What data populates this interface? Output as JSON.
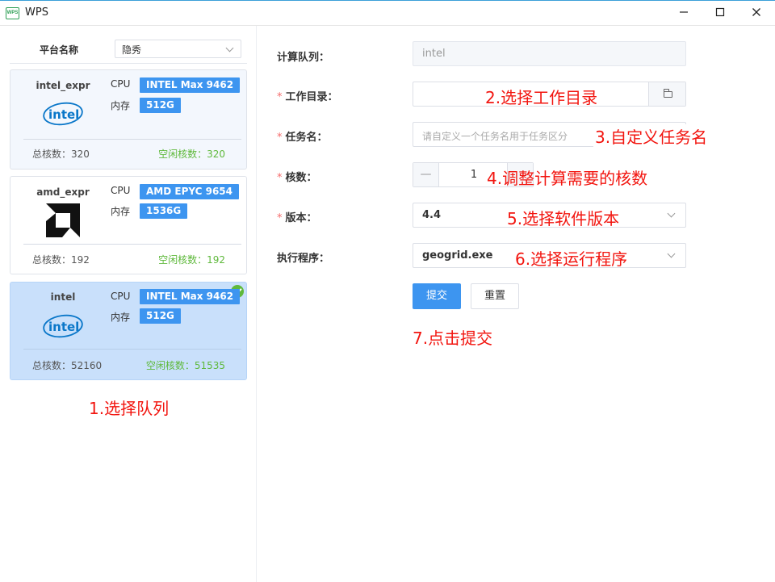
{
  "window": {
    "title": "WPS",
    "logo_text": "WPS"
  },
  "sidebar": {
    "filter": {
      "label": "平台名称",
      "value": "隐秀"
    },
    "cards": [
      {
        "name": "intel_expr",
        "cpu_label": "CPU",
        "cpu": "INTEL Max 9462",
        "mem_label": "内存",
        "mem": "512G",
        "total": "总核数：320",
        "free": "空闲核数：320",
        "logo": "intel-logo",
        "selected": false
      },
      {
        "name": "amd_expr",
        "cpu_label": "CPU",
        "cpu": "AMD EPYC 9654",
        "mem_label": "内存",
        "mem": "1536G",
        "total": "总核数：192",
        "free": "空闲核数：192",
        "logo": "amd-logo",
        "selected": false
      },
      {
        "name": "intel",
        "cpu_label": "CPU",
        "cpu": "INTEL Max 9462",
        "mem_label": "内存",
        "mem": "512G",
        "total": "总核数：52160",
        "free": "空闲核数：51535",
        "logo": "intel-logo",
        "selected": true
      }
    ]
  },
  "form": {
    "queue": {
      "label": "计算队列：",
      "value": "intel"
    },
    "workdir": {
      "label": "工作目录：",
      "required_mark": "*"
    },
    "taskname": {
      "label": "任务名：",
      "required_mark": "*",
      "placeholder": "请自定义一个任务名用于任务区分"
    },
    "cores": {
      "label": "核数：",
      "required_mark": "*",
      "value": "1",
      "minus": "—"
    },
    "version": {
      "label": "版本：",
      "required_mark": "*",
      "value": "4.4"
    },
    "program": {
      "label": "执行程序：",
      "value": "geogrid.exe"
    },
    "submit_label": "提交",
    "reset_label": "重置"
  },
  "annotations": {
    "step1": "1.选择队列",
    "step2": "2.选择工作目录",
    "step3": "3.自定义任务名",
    "step4": "4.调整计算需要的核数",
    "step5": "5.选择软件版本",
    "step6": "6.选择运行程序",
    "step7": "7.点击提交"
  },
  "colors": {
    "primary": "#3d95f0",
    "success": "#5fb93c",
    "annotation": "#f2150f",
    "selected_card": "#c9e0fb"
  }
}
